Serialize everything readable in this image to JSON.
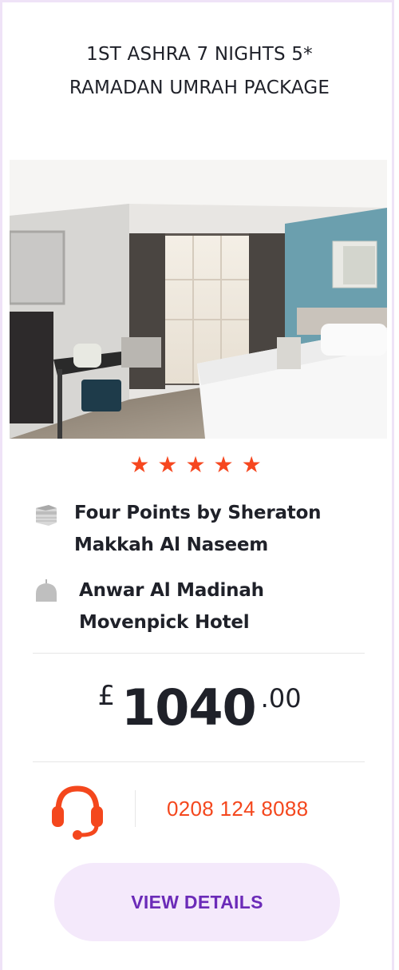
{
  "package": {
    "title": "1ST ASHRA 7 NIGHTS 5*\nRAMADAN UMRAH PACKAGE",
    "stars": "★★★★★",
    "star_rating": 5,
    "makkah_hotel": "Four Points by Sheraton Makkah Al Naseem",
    "madinah_hotel": "Anwar Al Madinah Movenpick Hotel",
    "price": {
      "currency": "£",
      "amount": "1040",
      "cents": ".00"
    },
    "phone": "0208 124 8088",
    "cta_label": "VIEW DETAILS"
  },
  "icons": {
    "kaaba": "kaaba-icon",
    "mosque": "mosque-icon",
    "support": "headset-icon"
  },
  "colors": {
    "accent": "#f4471d",
    "button_bg": "#f4e9fb",
    "button_text": "#6b2bb8",
    "text": "#1f2129"
  }
}
